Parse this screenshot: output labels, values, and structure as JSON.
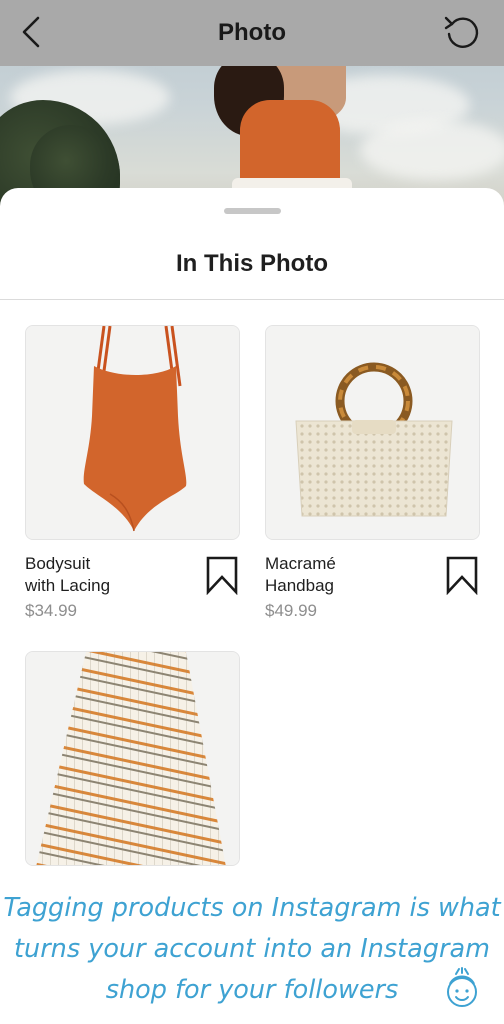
{
  "nav": {
    "title": "Photo",
    "back_icon": "chevron-left-icon",
    "reset_icon": "rotate-ccw-icon"
  },
  "sheet": {
    "title": "In This Photo"
  },
  "products": [
    {
      "name_line1": "Bodysuit",
      "name_line2": "with Lacing",
      "price": "$34.99",
      "image": "orange-bodysuit",
      "bookmark_icon": "bookmark-icon"
    },
    {
      "name_line1": "Macramé",
      "name_line2": "Handbag",
      "price": "$49.99",
      "image": "macrame-handbag",
      "bookmark_icon": "bookmark-icon"
    },
    {
      "name_line1": "",
      "name_line2": "",
      "price": "",
      "image": "striped-pleated-skirt",
      "bookmark_icon": ""
    }
  ],
  "caption": {
    "line1": "Tagging products on Instagram is what",
    "line2": "turns your account into an Instagram",
    "line3": "shop for your followers"
  },
  "colors": {
    "nav_bg": "#a9a9a9",
    "caption": "#3ea2d2",
    "price": "#8e8e8e",
    "swimsuit": "#d2652c"
  }
}
